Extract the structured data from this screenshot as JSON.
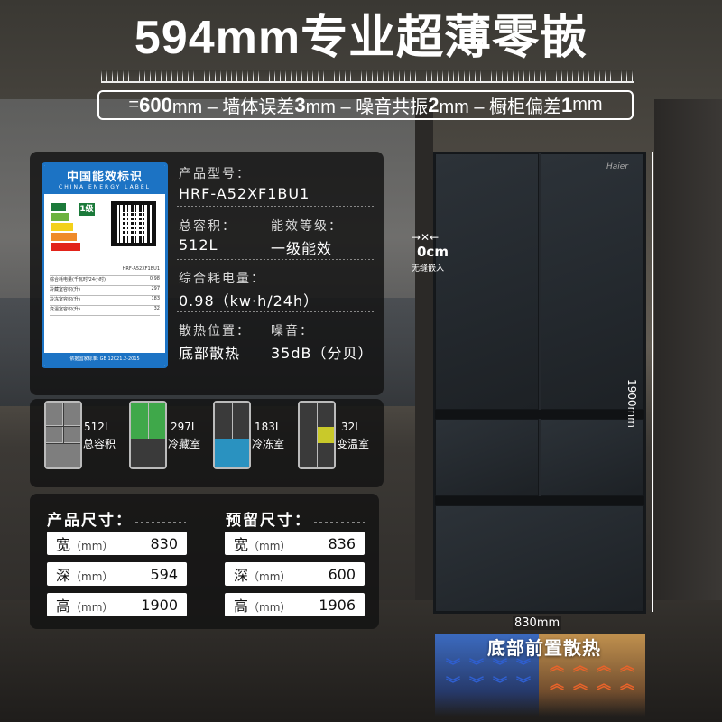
{
  "title": "594mm专业超薄零嵌",
  "formula": {
    "prefix": "= ",
    "v1": "600",
    "t1": "mm – 墙体误差",
    "v2": "3",
    "t2": "mm – 噪音共振",
    "v3": "2",
    "t3": "mm – 橱柜偏差",
    "v4": "1",
    "t4": "mm"
  },
  "energy_label": {
    "title": "中国能效标识",
    "subtitle": "CHINA ENERGY LABEL",
    "grade": "1级",
    "footer": "依据国家标准: GB 12021.2-2015",
    "model_line": "HRF-A52XF1BU1",
    "rows": [
      {
        "k": "综合耗电量(千瓦时/24小时)",
        "v": "0.98"
      },
      {
        "k": "冷藏室容积(升)",
        "v": "297"
      },
      {
        "k": "冷冻室容积(升)",
        "v": "183"
      },
      {
        "k": "变温室容积(升)",
        "v": "32"
      }
    ]
  },
  "specs": {
    "model_label": "产品型号：",
    "model_value": "HRF-A52XF1BU1",
    "volume_label": "总容积：",
    "volume_value": "512L",
    "grade_label": "能效等级：",
    "grade_value": "一级能效",
    "power_label": "综合耗电量：",
    "power_value": "0.98（kw·h/24h）",
    "heat_label": "散热位置：",
    "heat_value": "底部散热",
    "noise_label": "噪音：",
    "noise_value": "35dB（分贝）"
  },
  "compartments": [
    {
      "num": "512L",
      "name": "总容积",
      "color": "#8a8a8a"
    },
    {
      "num": "297L",
      "name": "冷藏室",
      "color": "#3fa84a"
    },
    {
      "num": "183L",
      "name": "冷冻室",
      "color": "#2a92c0"
    },
    {
      "num": "32L",
      "name": "变温室",
      "color": "#c9c92a"
    }
  ],
  "product_size": {
    "title": "产品尺寸：",
    "rows": [
      {
        "k": "宽",
        "unit": "（mm）",
        "v": "830"
      },
      {
        "k": "深",
        "unit": "（mm）",
        "v": "594"
      },
      {
        "k": "高",
        "unit": "（mm）",
        "v": "1900"
      }
    ]
  },
  "reserved_size": {
    "title": "预留尺寸：",
    "rows": [
      {
        "k": "宽",
        "unit": "（mm）",
        "v": "836"
      },
      {
        "k": "深",
        "unit": "（mm）",
        "v": "600"
      },
      {
        "k": "高",
        "unit": "（mm）",
        "v": "1906"
      }
    ]
  },
  "fridge": {
    "brand": "Haier",
    "gap_value": "0cm",
    "gap_text": "无缝嵌入",
    "height_text": "1900mm",
    "width_text": "830mm",
    "heat_text": "底部前置散热"
  },
  "colors": {
    "energy_blue": "#1c73c4",
    "cool_blue": "#3c6ec8",
    "warm_orange": "#c8965a"
  }
}
